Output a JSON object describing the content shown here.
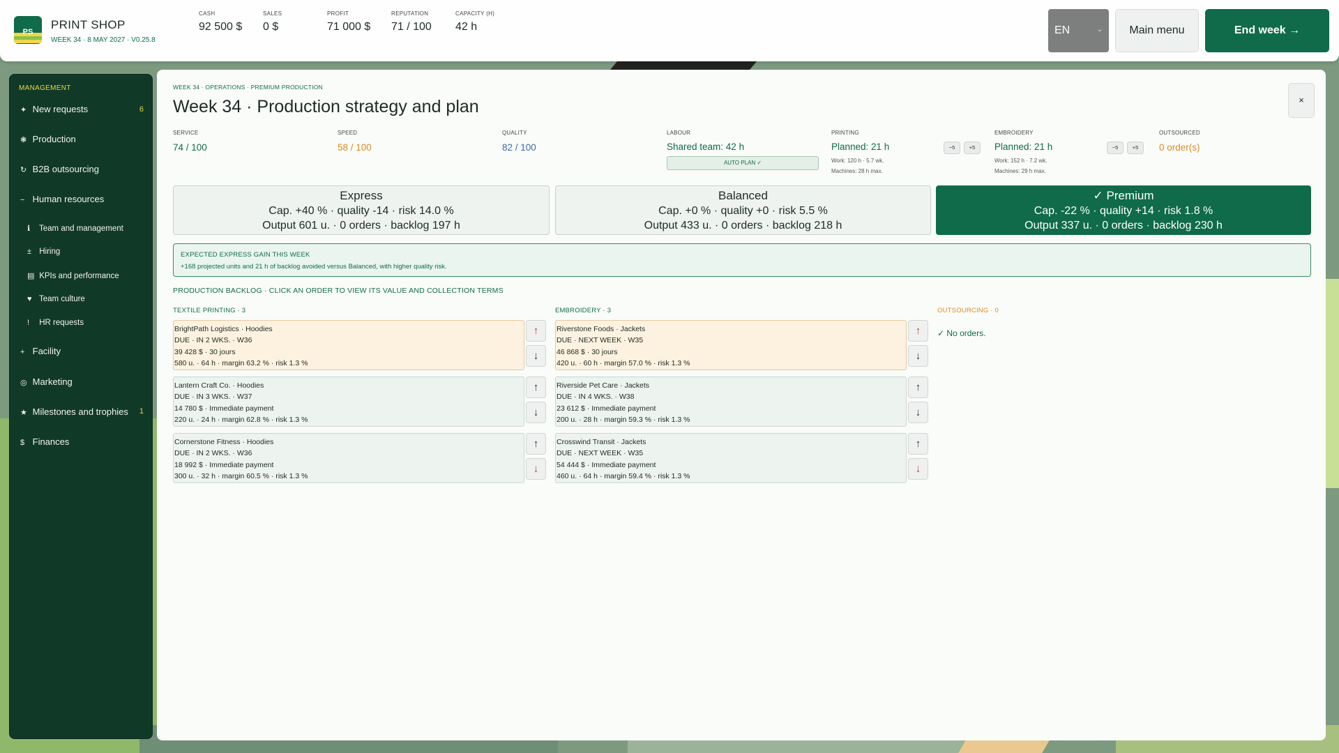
{
  "app": {
    "logo_text": "PS",
    "title": "PRINT SHOP",
    "subtitle": "WEEK 34 · 8 MAY 2027 · V0.25.8"
  },
  "stats": [
    {
      "label": "CASH",
      "value": "92 500 $"
    },
    {
      "label": "SALES",
      "value": "0 $"
    },
    {
      "label": "PROFIT",
      "value": "71 000 $"
    },
    {
      "label": "REPUTATION",
      "value": "71 / 100"
    },
    {
      "label": "CAPACITY (H)",
      "value": "42 h"
    }
  ],
  "topbar": {
    "language": "EN",
    "main_menu": "Main menu",
    "end_week": "End week →"
  },
  "sidebar": {
    "heading": "MANAGEMENT",
    "items": [
      {
        "icon": "✦",
        "label": "New requests",
        "badge": "6"
      },
      {
        "icon": "❃",
        "label": "Production",
        "badge": ""
      },
      {
        "icon": "↻",
        "label": "B2B outsourcing",
        "badge": ""
      },
      {
        "icon": "−",
        "label": "Human resources",
        "badge": ""
      },
      {
        "icon": "ℹ",
        "label": "Team and management",
        "badge": ""
      },
      {
        "icon": "±",
        "label": "Hiring",
        "badge": ""
      },
      {
        "icon": "▤",
        "label": "KPIs and performance",
        "badge": ""
      },
      {
        "icon": "♥",
        "label": "Team culture",
        "badge": ""
      },
      {
        "icon": "!",
        "label": "HR requests",
        "badge": ""
      },
      {
        "icon": "+",
        "label": "Facility",
        "badge": ""
      },
      {
        "icon": "◎",
        "label": "Marketing",
        "badge": ""
      },
      {
        "icon": "★",
        "label": "Milestones and trophies",
        "badge": "1"
      },
      {
        "icon": "$",
        "label": "Finances",
        "badge": ""
      }
    ]
  },
  "panel": {
    "breadcrumb": "WEEK 34 · OPERATIONS · PREMIUM PRODUCTION",
    "title": "Week 34 · Production strategy and plan",
    "close": "×",
    "metrics": {
      "service": {
        "label": "SERVICE",
        "value": "74 / 100"
      },
      "speed": {
        "label": "SPEED",
        "value": "58 / 100"
      },
      "quality": {
        "label": "QUALITY",
        "value": "82 / 100"
      },
      "labour": {
        "label": "LABOUR",
        "value": "Shared team: 42 h",
        "auto_plan": "AUTO PLAN ✓"
      },
      "printing": {
        "label": "PRINTING",
        "value": "Planned: 21 h",
        "work": "Work: 120 h · 5.7 wk.",
        "machines": "Machines: 28 h max.",
        "minus": "−5",
        "plus": "+5"
      },
      "embroidery": {
        "label": "EMBROIDERY",
        "value": "Planned: 21 h",
        "work": "Work: 152 h · 7.2 wk.",
        "machines": "Machines: 29 h max.",
        "minus": "−5",
        "plus": "+5"
      },
      "outsourced": {
        "label": "OUTSOURCED",
        "value": "0 order(s)"
      }
    },
    "strategies": [
      {
        "name": "Express",
        "line1": "Cap. +40 % · quality -14 · risk 14.0 %",
        "line2": "Output 601 u. · 0 orders · backlog 197 h",
        "selected": false
      },
      {
        "name": "Balanced",
        "line1": "Cap. +0 % · quality +0 · risk 5.5 %",
        "line2": "Output 433 u. · 0 orders · backlog 218 h",
        "selected": false
      },
      {
        "name": "✓ Premium",
        "line1": "Cap. -22 % · quality +14 · risk 1.8 %",
        "line2": "Output 337 u. · 0 orders · backlog 230 h",
        "selected": true
      }
    ],
    "gain": {
      "title": "EXPECTED EXPRESS GAIN THIS WEEK",
      "desc": "+168 projected units and 21 h of backlog avoided versus Balanced, with higher quality risk."
    },
    "backlog_heading": "PRODUCTION BACKLOG · CLICK AN ORDER TO VIEW ITS VALUE AND COLLECTION TERMS",
    "columns": {
      "textile": {
        "heading": "TEXTILE PRINTING · 3",
        "orders": [
          {
            "title": "BrightPath Logistics · Hoodies",
            "due": "DUE · IN 2 WKS. · W36",
            "terms": "39 428 $ · 30 jours",
            "stats": "580 u. · 64 h · margin 63.2 % · risk 1.3 %"
          },
          {
            "title": "Lantern Craft Co. · Hoodies",
            "due": "DUE · IN 3 WKS. · W37",
            "terms": "14 780 $ · Immediate payment",
            "stats": "220 u. · 24 h · margin 62.8 % · risk 1.3 %"
          },
          {
            "title": "Cornerstone Fitness · Hoodies",
            "due": "DUE · IN 2 WKS. · W36",
            "terms": "18 992 $ · Immediate payment",
            "stats": "300 u. · 32 h · margin 60.5 % · risk 1.3 %"
          }
        ]
      },
      "embroidery": {
        "heading": "EMBROIDERY · 3",
        "orders": [
          {
            "title": "Riverstone Foods · Jackets",
            "due": "DUE · NEXT WEEK · W35",
            "terms": "46 868 $ · 30 jours",
            "stats": "420 u. · 60 h · margin 57.0 % · risk 1.3 %"
          },
          {
            "title": "Riverside Pet Care · Jackets",
            "due": "DUE · IN 4 WKS. · W38",
            "terms": "23 612 $ · Immediate payment",
            "stats": "200 u. · 28 h · margin 59.3 % · risk 1.3 %"
          },
          {
            "title": "Crosswind Transit · Jackets",
            "due": "DUE · NEXT WEEK · W35",
            "terms": "54 444 $ · Immediate payment",
            "stats": "460 u. · 64 h · margin 59.4 % · risk 1.3 %"
          }
        ]
      },
      "outsourcing": {
        "heading": "OUTSOURCING · 0",
        "empty": "✓ No orders."
      }
    },
    "arrows": {
      "up": "↑",
      "down": "↓"
    }
  },
  "colors": {
    "brand_green": "#0f6b4a",
    "sidebar_bg": "#113927",
    "accent_yellow": "#e6d94a",
    "speed_orange": "#e08a1e",
    "quality_blue": "#3b6aa8",
    "highlight_order": "#fdf1df",
    "arrow_red": "#c0392b"
  }
}
